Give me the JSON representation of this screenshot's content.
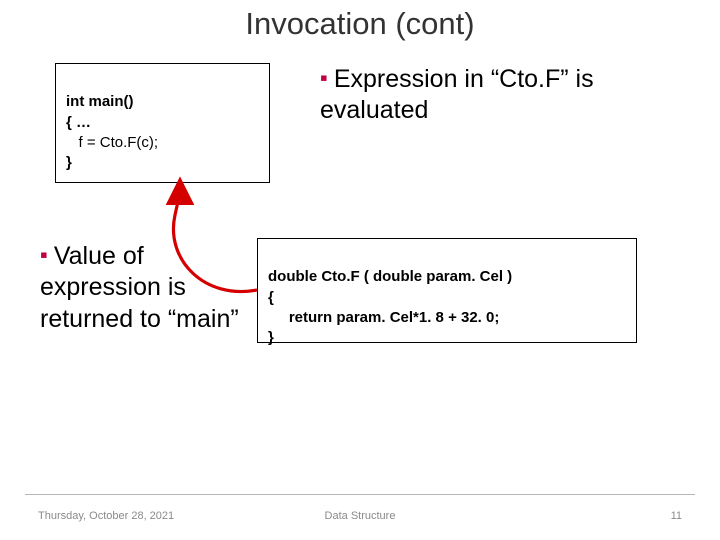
{
  "title": "Invocation (cont)",
  "code_main": {
    "l1": "int main()",
    "l2": "{ …",
    "l3": "   f = Cto.F(c);",
    "l4": "}"
  },
  "code_func": {
    "l1": "double Cto.F ( double param. Cel )",
    "l2": "{",
    "l3": "     return param. Cel*1. 8 + 32. 0;",
    "l4": "}"
  },
  "bullet_right": {
    "text": "Expression in “Cto.F” is evaluated"
  },
  "bullet_left": {
    "text": "Value of expression is returned to “main”"
  },
  "footer": {
    "date": "Thursday, October 28, 2021",
    "center": "Data Structure",
    "page": "11"
  }
}
